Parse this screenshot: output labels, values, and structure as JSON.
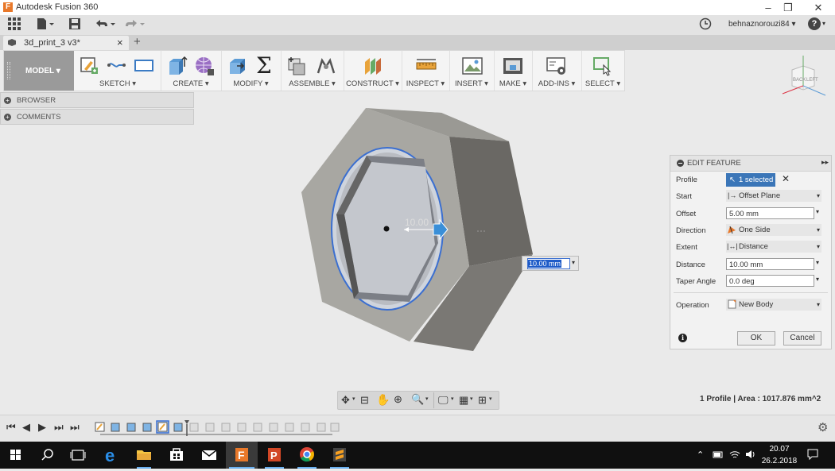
{
  "window": {
    "title": "Autodesk Fusion 360",
    "logo_letter": "F"
  },
  "appbar": {
    "user": "behnaznorouzi84 ▾",
    "help": "?"
  },
  "tab": {
    "name": "3d_print_3 v3*",
    "close": "×",
    "new": "+"
  },
  "ribbon": {
    "model": "MODEL ▾",
    "groups": [
      "SKETCH ▾",
      "CREATE ▾",
      "MODIFY ▾",
      "ASSEMBLE ▾",
      "CONSTRUCT ▾",
      "INSPECT ▾",
      "INSERT ▾",
      "MAKE ▾",
      "ADD-INS ▾",
      "SELECT ▾"
    ]
  },
  "panels": {
    "browser": "BROWSER",
    "comments": "COMMENTS"
  },
  "viewcube": {
    "back": "BACK",
    "left": "LEFT"
  },
  "viewport": {
    "dimension_label": "10.00",
    "distance_input": "10.00 mm"
  },
  "edit_feature": {
    "title": "EDIT FEATURE",
    "fields": [
      {
        "label": "Profile",
        "value": "1 selected"
      },
      {
        "label": "Start",
        "value": "Offset Plane"
      },
      {
        "label": "Offset",
        "value": "5.00 mm"
      },
      {
        "label": "Direction",
        "value": "One Side"
      },
      {
        "label": "Extent",
        "value": "Distance"
      },
      {
        "label": "Distance",
        "value": "10.00 mm"
      },
      {
        "label": "Taper Angle",
        "value": "0.0 deg"
      },
      {
        "label": "Operation",
        "value": "New Body"
      }
    ],
    "ok": "OK",
    "cancel": "Cancel"
  },
  "status": {
    "text": "1 Profile | Area : 1017.876 mm^2"
  },
  "taskbar": {
    "time": "20.07",
    "date": "26.2.2018"
  }
}
